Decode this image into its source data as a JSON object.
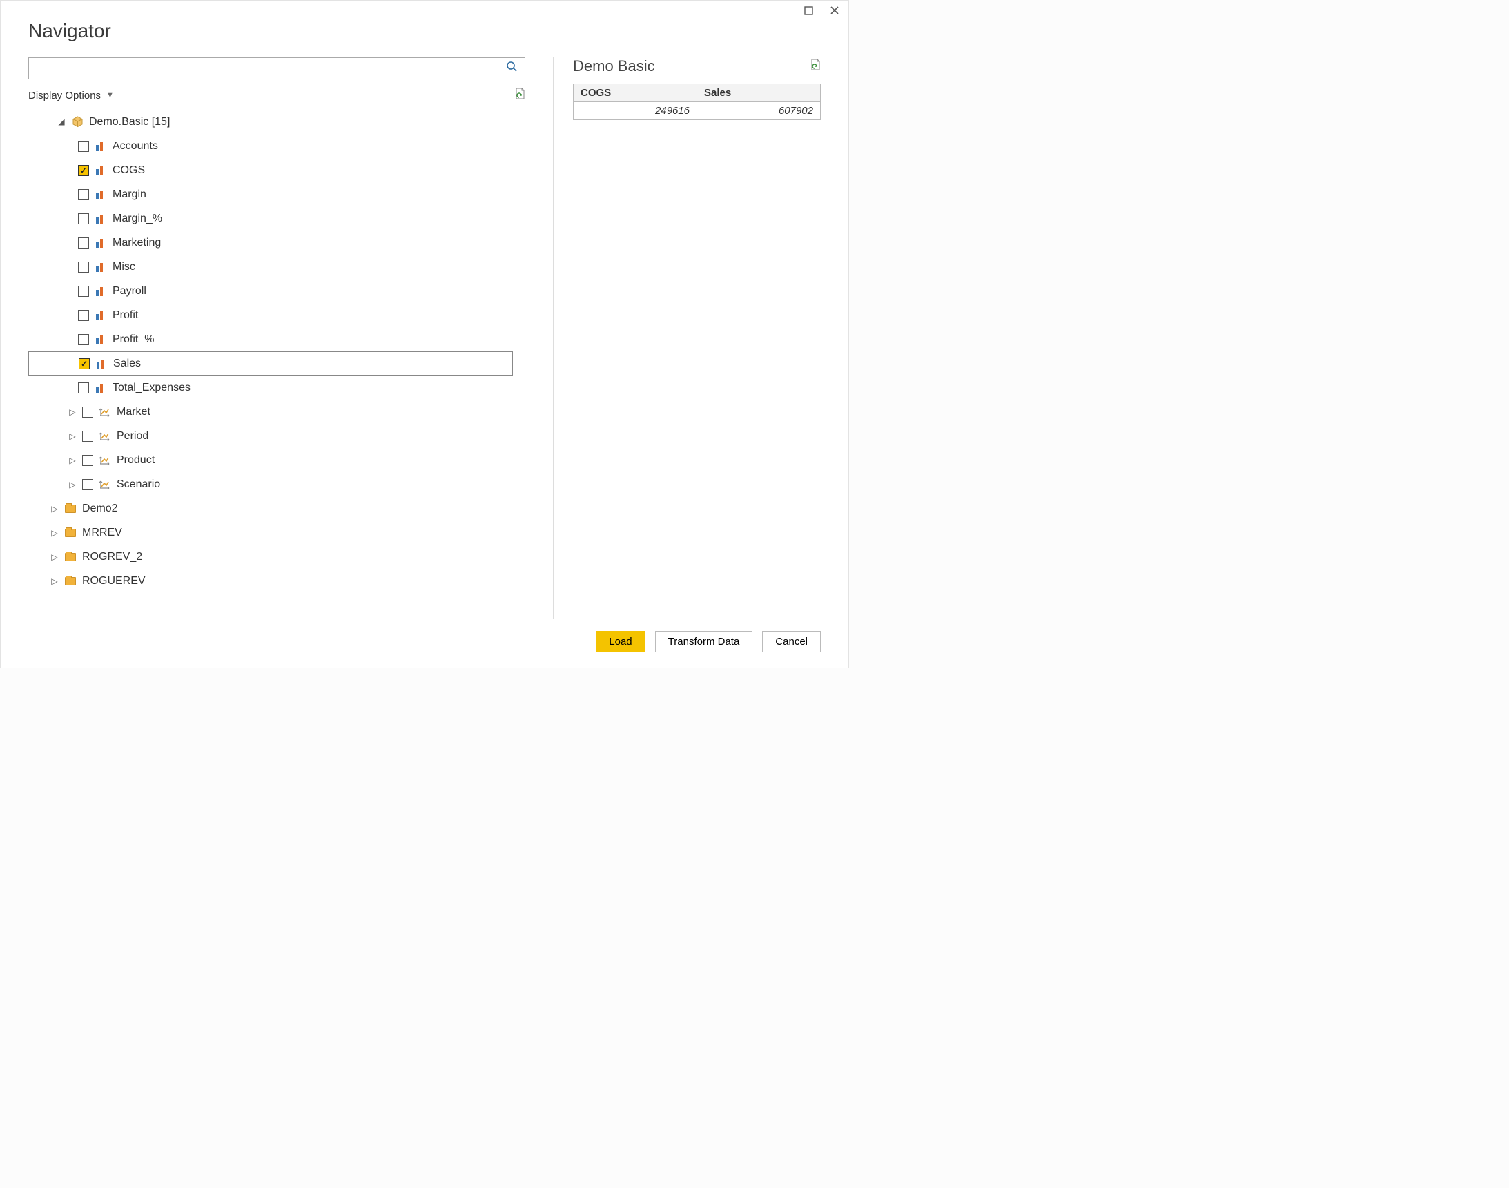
{
  "title": "Navigator",
  "search": {
    "placeholder": ""
  },
  "display_options_label": "Display Options",
  "tree": {
    "root_label": "Demo.Basic [15]",
    "items": [
      {
        "label": "Accounts",
        "checked": false,
        "type": "measure"
      },
      {
        "label": "COGS",
        "checked": true,
        "type": "measure"
      },
      {
        "label": "Margin",
        "checked": false,
        "type": "measure"
      },
      {
        "label": "Margin_%",
        "checked": false,
        "type": "measure"
      },
      {
        "label": "Marketing",
        "checked": false,
        "type": "measure"
      },
      {
        "label": "Misc",
        "checked": false,
        "type": "measure"
      },
      {
        "label": "Payroll",
        "checked": false,
        "type": "measure"
      },
      {
        "label": "Profit",
        "checked": false,
        "type": "measure"
      },
      {
        "label": "Profit_%",
        "checked": false,
        "type": "measure"
      },
      {
        "label": "Sales",
        "checked": true,
        "type": "measure",
        "selected": true
      },
      {
        "label": "Total_Expenses",
        "checked": false,
        "type": "measure"
      },
      {
        "label": "Market",
        "checked": false,
        "type": "hier"
      },
      {
        "label": "Period",
        "checked": false,
        "type": "hier"
      },
      {
        "label": "Product",
        "checked": false,
        "type": "hier"
      },
      {
        "label": "Scenario",
        "checked": false,
        "type": "hier"
      }
    ],
    "siblings": [
      {
        "label": "Demo2"
      },
      {
        "label": "MRREV"
      },
      {
        "label": "ROGREV_2"
      },
      {
        "label": "ROGUEREV"
      }
    ]
  },
  "preview": {
    "title": "Demo Basic",
    "columns": [
      "COGS",
      "Sales"
    ],
    "rows": [
      [
        "249616",
        "607902"
      ]
    ]
  },
  "buttons": {
    "load": "Load",
    "transform": "Transform Data",
    "cancel": "Cancel"
  }
}
